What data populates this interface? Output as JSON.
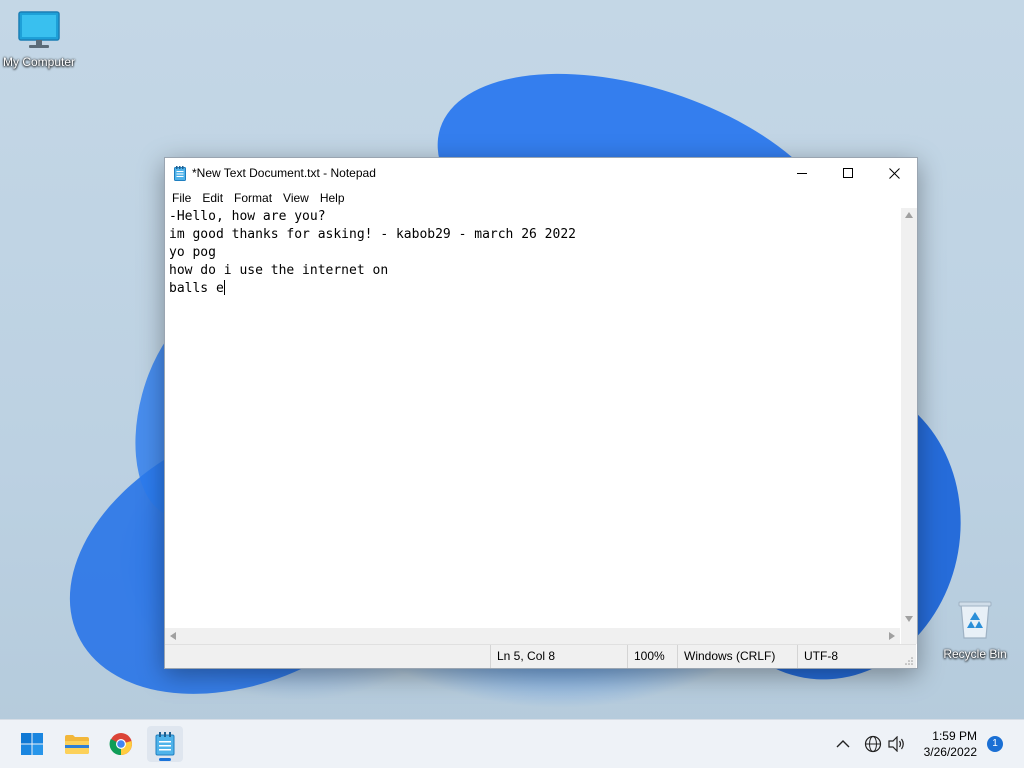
{
  "desktop": {
    "icons": [
      {
        "label": "My Computer"
      },
      {
        "label": "Recycle Bin"
      }
    ]
  },
  "window": {
    "title": "*New Text Document.txt - Notepad",
    "menu": [
      "File",
      "Edit",
      "Format",
      "View",
      "Help"
    ],
    "content_lines": [
      "-Hello, how are you?",
      "im good thanks for asking! - kabob29 - march 26 2022",
      "yo pog",
      "how do i use the internet on",
      "balls e"
    ],
    "status": {
      "position": "Ln 5, Col 8",
      "zoom": "100%",
      "line_ending": "Windows (CRLF)",
      "encoding": "UTF-8"
    }
  },
  "taskbar": {
    "time": "1:59 PM",
    "date": "3/26/2022",
    "notification_count": "1"
  },
  "colors": {
    "accent": "#1a73d9"
  }
}
